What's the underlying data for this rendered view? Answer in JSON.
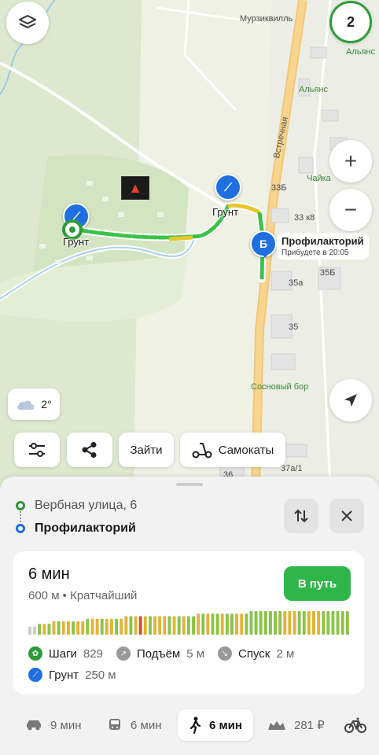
{
  "map": {
    "labels": {
      "murzikville": "Мурзиквилль",
      "alyans_top": "Альянс",
      "alyans": "Альянс",
      "vstrechnaya": "Встречная",
      "chayka": "Чайка",
      "h33b": "33Б",
      "h33k8": "33 к8",
      "h35a": "35а",
      "h35b": "35Б",
      "h35": "35",
      "sosnovy": "Сосновый бор",
      "h36": "36",
      "h37a1": "37а/1"
    },
    "layers_badge": "2",
    "zoom_in": "+",
    "zoom_out": "−",
    "pin_start_label": "Грунт",
    "pin_mid_label": "Грунт",
    "pin_dest_letter": "Б",
    "dest_title": "Профилакторий",
    "dest_eta": "Прибудете в 20:05",
    "weather_temp": "2°"
  },
  "actions": {
    "enter": "Зайти",
    "scooters": "Самокаты"
  },
  "waypoints": {
    "from": "Вербная улица, 6",
    "to": "Профилакторий"
  },
  "route": {
    "duration": "6 мин",
    "distance_info": "600 м • Кратчайший",
    "go": "В путь",
    "elevation_profile": [
      2,
      2,
      3,
      3,
      3,
      4,
      4,
      4,
      4,
      4,
      4,
      4,
      5,
      5,
      5,
      5,
      5,
      5,
      5,
      5,
      6,
      6,
      6,
      6,
      6,
      6,
      6,
      6,
      6,
      6,
      6,
      6,
      6,
      6,
      6,
      7,
      7,
      7,
      7,
      7,
      7,
      7,
      7,
      7,
      7,
      7,
      8,
      8,
      8,
      8,
      8,
      8,
      8,
      8,
      8,
      8,
      8,
      8,
      8,
      8,
      8,
      8,
      8,
      8,
      8,
      8,
      8
    ],
    "elevation_colors": [
      "#ccc",
      "#ccc",
      "#8bc34a",
      "#e0b43a",
      "#8bc34a",
      "#e0b43a",
      "#8bc34a",
      "#e0b43a",
      "#e0b43a",
      "#8bc34a",
      "#e0b43a",
      "#e0b43a",
      "#8bc34a",
      "#e0b43a",
      "#e0b43a",
      "#8bc34a",
      "#e0b43a",
      "#e0b43a",
      "#8bc34a",
      "#e0b43a",
      "#e0b43a",
      "#8bc34a",
      "#e0b43a",
      "#d94a3a",
      "#e0b43a",
      "#8bc34a",
      "#e0b43a",
      "#e0b43a",
      "#e0b43a",
      "#8bc34a",
      "#e0b43a",
      "#8bc34a",
      "#e0b43a",
      "#8bc34a",
      "#8bc34a",
      "#e0b43a",
      "#8bc34a",
      "#e0b43a",
      "#8bc34a",
      "#8bc34a",
      "#e0b43a",
      "#8bc34a",
      "#8bc34a",
      "#e0b43a",
      "#e0b43a",
      "#8bc34a",
      "#8bc34a",
      "#8bc34a",
      "#8bc34a",
      "#8bc34a",
      "#8bc34a",
      "#8bc34a",
      "#8bc34a",
      "#e0b43a",
      "#e0b43a",
      "#e0b43a",
      "#8bc34a",
      "#8bc34a",
      "#e0b43a",
      "#e0b43a",
      "#e0b43a",
      "#8bc34a",
      "#8bc34a",
      "#8bc34a",
      "#8bc34a",
      "#8bc34a",
      "#8bc34a"
    ],
    "stats": {
      "steps_label": "Шаги",
      "steps_val": "829",
      "up_label": "Подъём",
      "up_val": "5 м",
      "down_label": "Спуск",
      "down_val": "2 м",
      "ground_label": "Грунт",
      "ground_val": "250 м"
    }
  },
  "modes": {
    "car": "9 мин",
    "bus": "6 мин",
    "walk": "6 мин",
    "taxi": "281 ₽"
  },
  "colors": {
    "green": "#2fb64a",
    "blue": "#1f6fe0",
    "route_green": "#3cc24a"
  }
}
